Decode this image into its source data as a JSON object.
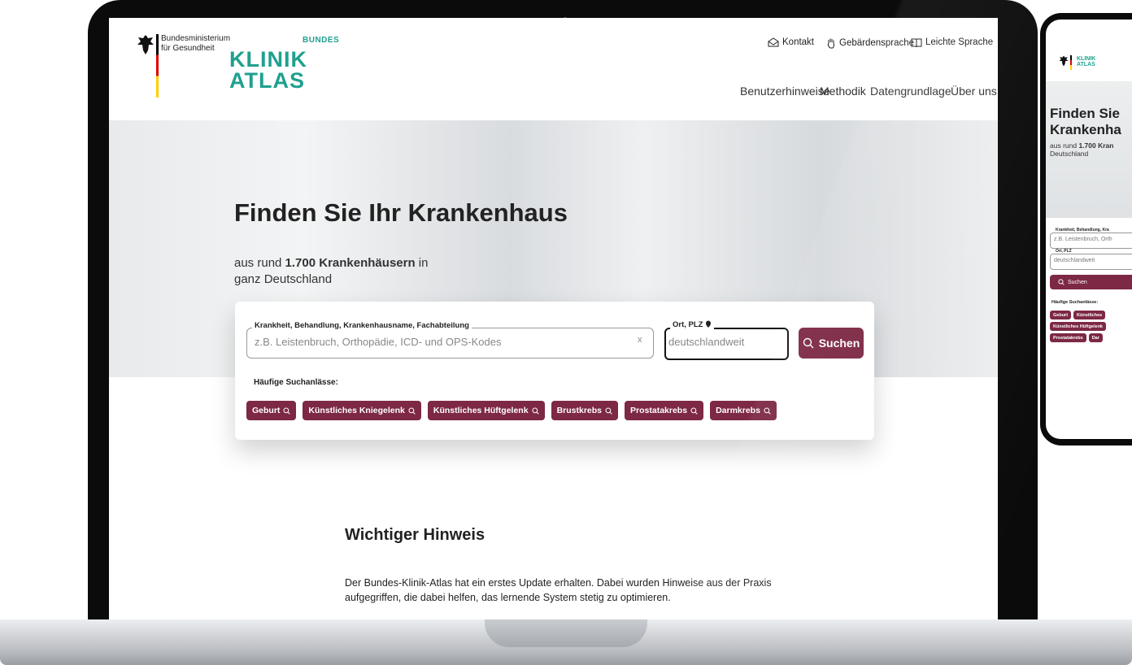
{
  "header": {
    "ministry_line1": "Bundesministerium",
    "ministry_line2": "für Gesundheit",
    "brand_small": "BUNDES",
    "brand_line1": "KLINIK",
    "brand_line2": "ATLAS",
    "util_links": [
      {
        "label": "Kontakt",
        "icon": "mail-icon"
      },
      {
        "label": "Gebärdensprache",
        "icon": "hand-icon"
      },
      {
        "label": "Leichte Sprache",
        "icon": "book-icon"
      }
    ],
    "nav": [
      "Benutzerhinweise",
      "Methodik",
      "Datengrundlage",
      "Über uns"
    ]
  },
  "hero": {
    "title": "Finden Sie Ihr Krankenhaus",
    "sub_prefix": "aus rund ",
    "sub_bold": "1.700 Krankenhäusern",
    "sub_suffix": " in ganz Deutschland"
  },
  "search": {
    "field1_label": "Krankheit, Behandlung, Krankenhausname, Fachabteilung",
    "field1_placeholder": "z.B. Leistenbruch, Orthopädie, ICD- und OPS-Kodes",
    "clear": "x",
    "field2_label": "Ort, PLZ",
    "field2_placeholder": "deutschlandweit",
    "button": "Suchen",
    "common_label": "Häufige Suchanlässe:",
    "chips": [
      "Geburt",
      "Künstliches Kniegelenk",
      "Künstliches Hüftgelenk",
      "Brustkrebs",
      "Prostatakrebs",
      "Darmkrebs"
    ]
  },
  "notice": {
    "title": "Wichtiger Hinweis",
    "text": "Der Bundes-Klinik-Atlas hat ein erstes Update erhalten. Dabei wurden Hinweise aus der Praxis aufgegriffen, die dabei helfen, das lernende System stetig zu optimieren."
  },
  "phone": {
    "logo_line1": "KLINIK",
    "logo_line2": "ATLAS",
    "title_line1": "Finden Sie",
    "title_line2": "Krankenha",
    "sub_prefix": "aus rund ",
    "sub_bold": "1.700 Kran",
    "sub_line2": "Deutschland",
    "field1_label": "Krankheit, Behandlung, Kra",
    "field1_placeholder": "z.B. Leistenbruch, Orth",
    "field2_label": "Ort, PLZ",
    "field2_placeholder": "deutschlandweit",
    "button": "Suchen",
    "common_label": "Häufige Suchanlässe:",
    "chips_row1": [
      "Geburt",
      "Künstliches"
    ],
    "chips_row2": [
      "Künstliches Hüftgelenk"
    ],
    "chips_row3": [
      "Prostatakrebs",
      "Dar"
    ]
  },
  "colors": {
    "brand": "#1fa08f",
    "accent": "#7d2844"
  }
}
